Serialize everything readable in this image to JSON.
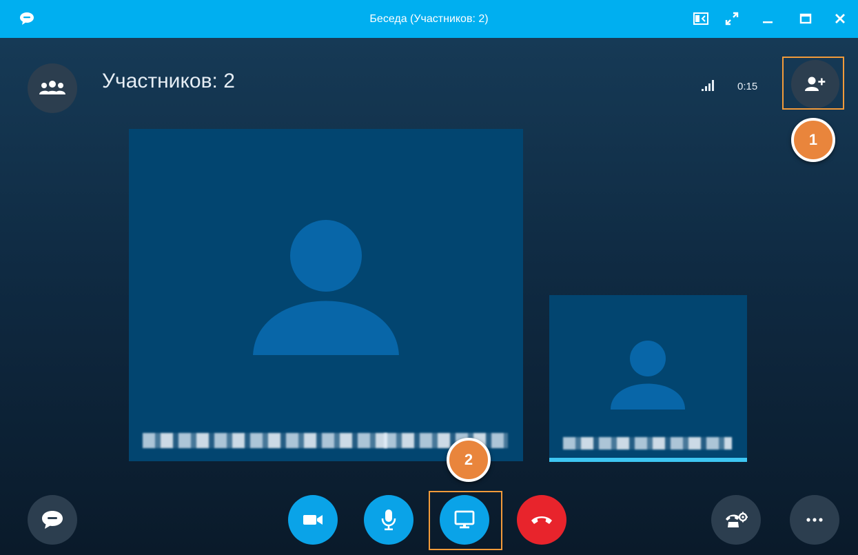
{
  "window": {
    "title": "Беседа (Участников: 2)",
    "icons": [
      "chat-bubble-icon",
      "compact-view-icon",
      "fullscreen-icon",
      "minimize-icon",
      "maximize-icon",
      "close-icon"
    ]
  },
  "header": {
    "participants_label": "Участников: 2",
    "timer": "0:15",
    "icons": [
      "participants-icon",
      "signal-strength-icon",
      "add-person-icon"
    ]
  },
  "annotations": {
    "badge1": "1",
    "badge2": "2"
  },
  "controls": {
    "left": [
      "chat-icon"
    ],
    "center": [
      "video-icon",
      "microphone-icon",
      "screen-share-icon",
      "hang-up-icon"
    ],
    "right": [
      "call-settings-icon",
      "more-icon"
    ]
  },
  "colors": {
    "titlebar": "#00aff0",
    "tile": "#024570",
    "accent_blue": "#0aa3e8",
    "hangup_red": "#e8242c",
    "annotation_orange": "#e9853c"
  }
}
